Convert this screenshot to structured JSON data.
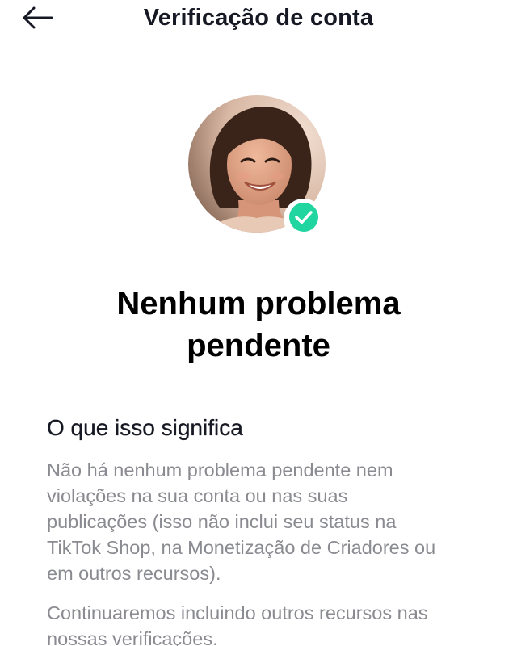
{
  "header": {
    "title": "Verificação de conta",
    "back_icon": "arrow-left-icon"
  },
  "profile": {
    "verified_icon": "check-circle-icon",
    "verified_color": "#20d5a0"
  },
  "status": {
    "title_line1": "Nenhum problema",
    "title_line2": "pendente"
  },
  "info": {
    "heading": "O que isso significa",
    "paragraph1_lines": [
      "Não há nenhum problema pendente nem",
      "violações na sua conta ou nas suas",
      "publicações (isso não inclui seu status na",
      "TikTok Shop, na Monetização de Criadores ou",
      "em outros recursos)."
    ],
    "paragraph2_lines": [
      "Continuaremos incluindo outros recursos nas",
      "nossas verificações."
    ]
  }
}
